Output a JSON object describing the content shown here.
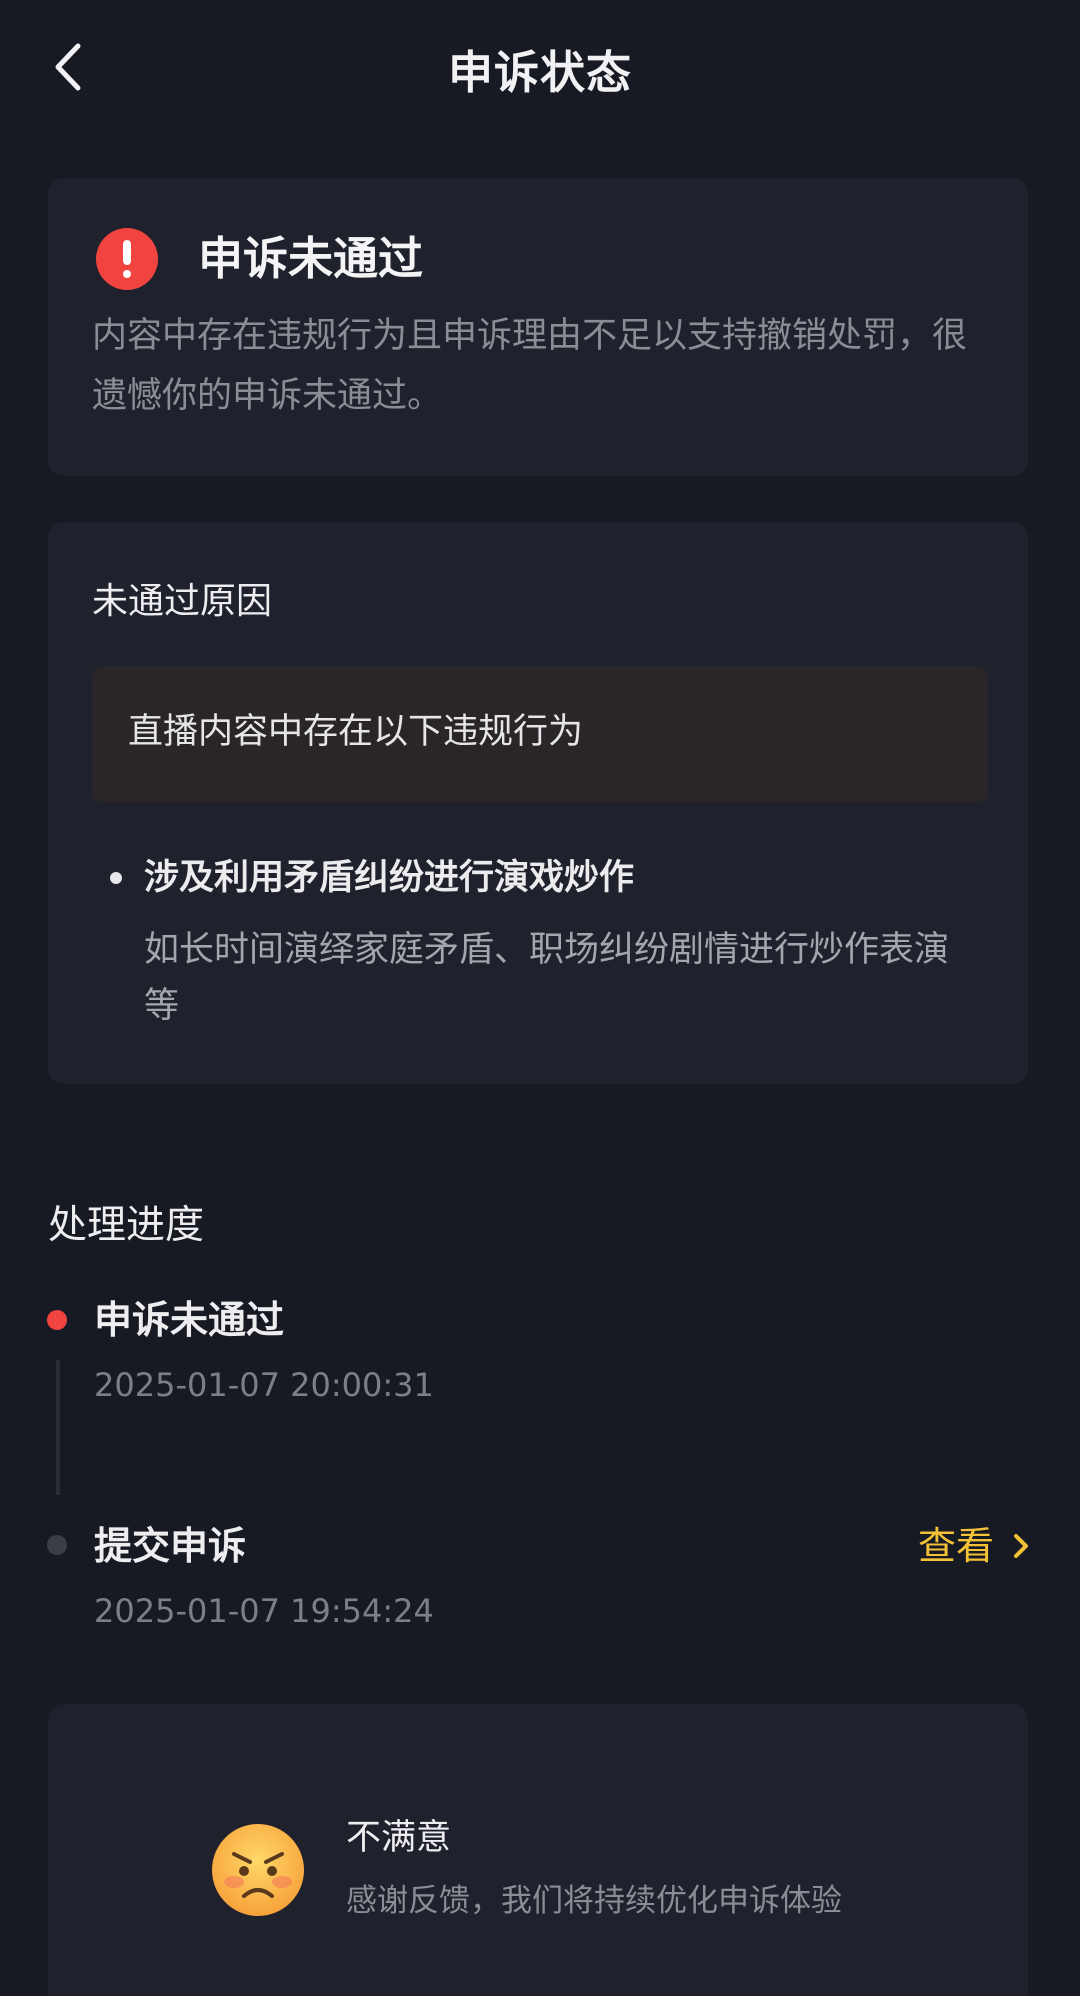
{
  "header": {
    "back_icon": "chevron-left-icon",
    "title": "申诉状态"
  },
  "status": {
    "icon": "alert-circle-icon",
    "icon_color": "#f1433f",
    "title": "申诉未通过",
    "description": "内容中存在违规行为且申诉理由不足以支持撤销处罚，很遗憾你的申诉未通过。"
  },
  "reason": {
    "title": "未通过原因",
    "box_text": "直播内容中存在以下违规行为",
    "items": [
      {
        "title": "涉及利用矛盾纠纷进行演戏炒作",
        "description": "如长时间演绎家庭矛盾、职场纠纷剧情进行炒作表演等"
      }
    ]
  },
  "progress": {
    "title": "处理进度",
    "steps": [
      {
        "title": "申诉未通过",
        "time": "2025-01-07 20:00:31",
        "active": true
      },
      {
        "title": "提交申诉",
        "time": "2025-01-07 19:54:24",
        "active": false,
        "action_label": "查看"
      }
    ]
  },
  "feedback": {
    "emoji": "angry-face-icon",
    "title": "不满意",
    "description": "感谢反馈，我们将持续优化申诉体验"
  },
  "colors": {
    "background": "#171923",
    "card": "#1f212c",
    "accent_red": "#f1433f",
    "link_yellow": "#f5c236"
  }
}
